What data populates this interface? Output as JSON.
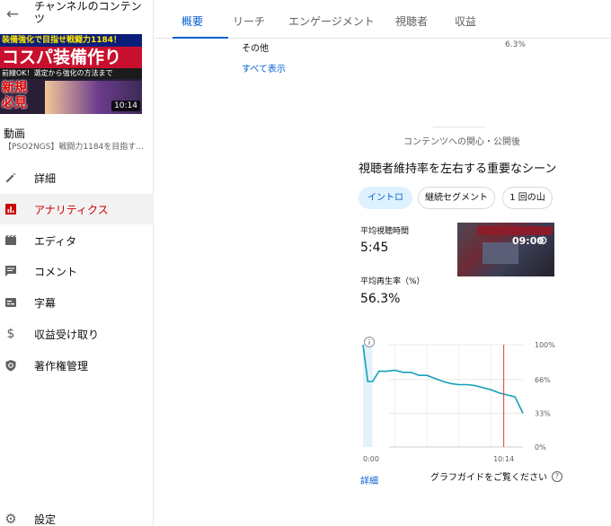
{
  "sidebar": {
    "title": "チャンネルのコンテンツ",
    "thumbnail": {
      "line1": "装備強化で目指せ戦闘力1184！",
      "line2": "コスパ装備作り",
      "line3": "前線OK！選定から強化の方法まで",
      "badge": "新規必見",
      "duration": "10:14"
    },
    "video_heading": "動画",
    "video_title": "【PSO2NGS】戦闘力1184を目指す...",
    "items": [
      {
        "label": "詳細"
      },
      {
        "label": "アナリティクス"
      },
      {
        "label": "エディタ"
      },
      {
        "label": "コメント"
      },
      {
        "label": "字幕"
      },
      {
        "label": "収益受け取り"
      },
      {
        "label": "著作権管理"
      }
    ],
    "settings_label": "設定"
  },
  "tabs": [
    {
      "label": "概要"
    },
    {
      "label": "リーチ"
    },
    {
      "label": "エンゲージメント"
    },
    {
      "label": "視聴者"
    },
    {
      "label": "収益"
    }
  ],
  "traffic": {
    "other_label": "その他",
    "other_value": "6.3%",
    "show_all": "すべて表示"
  },
  "retention": {
    "section_label": "コンテンツへの関心・公開後",
    "title": "視聴者維持率を左右する重要なシーン",
    "chips": [
      {
        "label": "イントロ"
      },
      {
        "label": "継続セグメント"
      },
      {
        "label": "1 回の山"
      }
    ],
    "avg_duration_label": "平均視聴時間",
    "avg_duration_value": "5:45",
    "avg_rate_label": "平均再生率（%）",
    "avg_rate_value": "56.3%",
    "frame_time": "09:00",
    "detail_link": "詳細",
    "guide_text": "グラフガイドをご覧ください"
  },
  "colors": {
    "accent_blue": "#065fd4",
    "active_red": "#cc0000",
    "line_teal": "#16a0b8",
    "marker_red": "#e53935"
  },
  "chart_data": {
    "type": "line",
    "x": [
      0,
      0.03,
      0.06,
      0.1,
      0.15,
      0.2,
      0.25,
      0.3,
      0.35,
      0.4,
      0.45,
      0.5,
      0.55,
      0.6,
      0.65,
      0.7,
      0.75,
      0.8,
      0.85,
      0.9,
      0.95,
      1.0
    ],
    "values": [
      100,
      64,
      64,
      74,
      74,
      75,
      73,
      73,
      70,
      70,
      67,
      64,
      62,
      61,
      61,
      60,
      58,
      56,
      53,
      51,
      49,
      33
    ],
    "x_tick_labels": [
      "0:00",
      "10:14"
    ],
    "y_tick_labels": [
      "100%",
      "66%",
      "33%",
      "0%"
    ],
    "y_ticks": [
      100,
      66,
      33,
      0
    ],
    "ylim": [
      0,
      100
    ],
    "xlim": [
      0,
      1
    ],
    "intro_segment_end": 0.06,
    "marker_position": 0.88,
    "grid": true
  }
}
